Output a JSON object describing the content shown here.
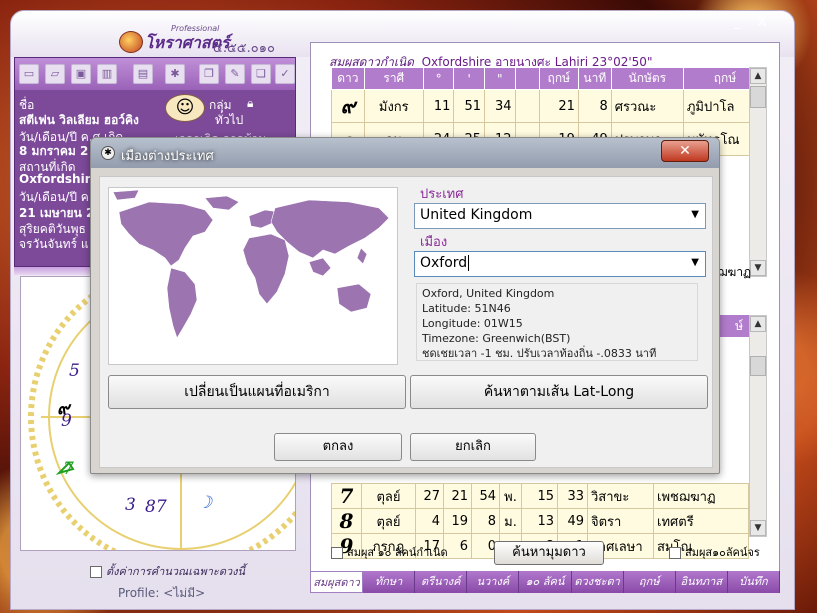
{
  "app": {
    "title": "โหราศาสตร์",
    "version": "๕.๕๕.๐๑๐",
    "edition": "Professional",
    "minimize": "_",
    "close": "X"
  },
  "left": {
    "name_label": "ชื่อ",
    "name_value": "สตีเฟน วิลเลียม ฮอว์คิง",
    "group_label": "กลุ่ม",
    "group_value": "ทั่วไป",
    "dob_label": "วัน/เดือน/ปี ค.ศ.เกิด",
    "time_label": "เวลาเกิด จากบ้าน",
    "dob_value": "8 มกราคม 2",
    "place_label": "สถานที่เกิด",
    "place_value": "Oxfordshire",
    "date2_label": "วัน/เดือน/ปี ค.ศ.",
    "date2_value": "21 เมษายน 2",
    "epoch_value": "สุริยคติวันพุธ",
    "weekday_value": "จรวันจันทร์ แ",
    "chart_numbers": [
      "5",
      "๙",
      "9",
      "7",
      "3",
      "87",
      "ห"
    ],
    "checkbox_label": "ตั้งค่าการคำนวณเฉพาะดวงนี้",
    "profile_label": "Profile:",
    "profile_value": "<ไม่มี>"
  },
  "right": {
    "header_label": "สมผุสดาวกำเนิด",
    "header_value": "Oxfordshire อายนางศะ Lahiri 23°02'50\"",
    "columns": [
      "ดาว",
      "ราศี",
      "°",
      "'",
      "\"",
      "",
      "ฤกษ์",
      "นาที",
      "นักษัตร",
      "ฤกษ์"
    ],
    "rows": [
      [
        "๙",
        "มังกร",
        "11",
        "51",
        "34",
        "",
        "21",
        "8",
        "ศรวณะ",
        "ภูมิปาโล"
      ],
      [
        "๑",
        "ธนู",
        "24",
        "25",
        "12",
        "",
        "19",
        "49",
        "ปุรพาษาฒ",
        "มหัทธโณ"
      ]
    ],
    "bottom_col": "ษ์",
    "bottom_rows": [
      [
        "7",
        "ตุลย์",
        "27",
        "21",
        "54",
        "พ.",
        "15",
        "33",
        "วิสาขะ",
        "เพชฌฆาฏ"
      ],
      [
        "8",
        "ตุลย์",
        "4",
        "19",
        "8",
        "ม.",
        "13",
        "49",
        "จิตรา",
        "เทศตรี"
      ],
      [
        "9",
        "กรกฎ",
        "17",
        "6",
        "0",
        "",
        "8",
        "1",
        "อาศเลษา",
        "สมโณ"
      ]
    ],
    "extra_right": "เพชฌฆาฏ",
    "check_birth": "สมผุส ๑๐ ลัคน์กำเนิด",
    "check_transit": "สมผุส๑๐ลัคน์จร",
    "find_button": "ค้นหามุมดาว",
    "tabs": [
      "สมผุสดาว",
      "ทักษา",
      "ตรีนางค์",
      "นวางค์",
      "๑๐ ลัคน์",
      "ดวงชะตา",
      "ฤกษ์",
      "อินทภาส",
      "บันทึก"
    ]
  },
  "dialog": {
    "title": "เมืองต่างประเทศ",
    "country_label": "ประเทศ",
    "country_value": "United Kingdom",
    "city_label": "เมือง",
    "city_value": "Oxford",
    "info": [
      "Oxford, United Kingdom",
      "Latitude: 51N46",
      "Longitude: 01W15",
      "Timezone: Greenwich(BST)",
      "ชดเชยเวลา -1 ชม. ปรับเวลาท้องถิ่น -.0833 นาที"
    ],
    "america_map_button": "เปลี่ยนเป็นแผนที่อเมริกา",
    "latlong_button": "ค้นหาตามเส้น Lat-Long",
    "ok_button": "ตกลง",
    "cancel_button": "ยกเลิก"
  }
}
